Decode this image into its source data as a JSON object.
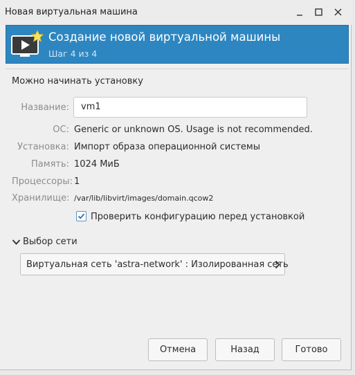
{
  "window": {
    "title": "Новая виртуальная машина"
  },
  "banner": {
    "title": "Создание новой виртуальной машины",
    "step": "Шаг 4 из 4"
  },
  "summary": {
    "heading": "Можно начинать установку",
    "name_label": "Название:",
    "name_value": "vm1",
    "os_label": "ОС:",
    "os_value": "Generic or unknown OS. Usage is not recommended.",
    "install_label": "Установка:",
    "install_value": "Импорт образа операционной системы",
    "memory_label": "Память:",
    "memory_value": "1024 МиБ",
    "cpus_label": "Процессоры:",
    "cpus_value": "1",
    "storage_label": "Хранилище:",
    "storage_value": "/var/lib/libvirt/images/domain.qcow2",
    "customize_label": "Проверить конфигурацию перед установкой",
    "customize_checked": true
  },
  "network": {
    "expander_label": "Выбор сети",
    "selected": "Виртуальная сеть 'astra-network' : Изолированная сеть"
  },
  "buttons": {
    "cancel": "Отмена",
    "back": "Назад",
    "finish": "Готово"
  },
  "colors": {
    "banner": "#2e86c1",
    "checkbox_accent": "#2f6fa8"
  }
}
